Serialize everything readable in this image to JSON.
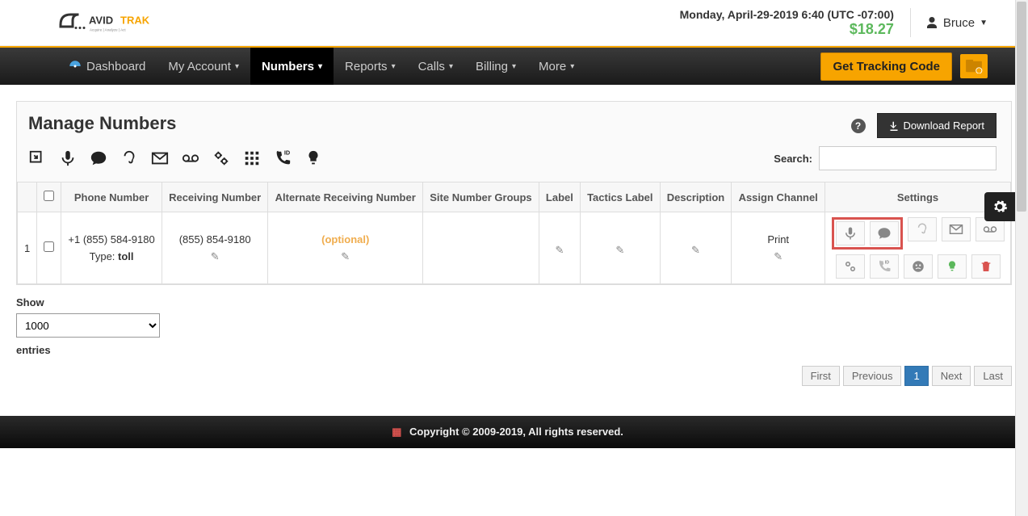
{
  "brand": {
    "name": "AVIDTRAK",
    "tagline": "Acquire | Analyze | Act"
  },
  "header": {
    "datetime": "Monday, April-29-2019 6:40 (UTC -07:00)",
    "balance": "$18.27",
    "user_name": "Bruce"
  },
  "nav": {
    "items": [
      {
        "label": "Dashboard"
      },
      {
        "label": "My Account"
      },
      {
        "label": "Numbers"
      },
      {
        "label": "Reports"
      },
      {
        "label": "Calls"
      },
      {
        "label": "Billing"
      },
      {
        "label": "More"
      }
    ],
    "get_code_label": "Get Tracking Code"
  },
  "page": {
    "title": "Manage Numbers",
    "download_label": "Download Report",
    "search_label": "Search:",
    "search_value": ""
  },
  "table": {
    "headers": {
      "phone_number": "Phone Number",
      "receiving_number": "Receiving Number",
      "alt_receiving_number": "Alternate Receiving Number",
      "site_number_groups": "Site Number Groups",
      "label": "Label",
      "tactics_label": "Tactics Label",
      "description": "Description",
      "assign_channel": "Assign Channel",
      "settings": "Settings"
    },
    "rows": [
      {
        "idx": "1",
        "phone_number": "+1 (855) 584-9180",
        "type_label": "Type:",
        "type_value": "toll",
        "receiving_number": "(855) 854-9180",
        "alt_receiving_number": "(optional)",
        "assign_channel": "Print"
      }
    ]
  },
  "list_controls": {
    "show_label": "Show",
    "show_value": "1000",
    "entries_label": "entries"
  },
  "pagination": {
    "first": "First",
    "previous": "Previous",
    "current": "1",
    "next": "Next",
    "last": "Last"
  },
  "footer": {
    "copyright": "Copyright © 2009-2019, All rights reserved."
  },
  "colors": {
    "accent_orange": "#f7a400",
    "success_green": "#5cb85c",
    "danger_red": "#d9534f",
    "nav_bg": "#1a1a1a"
  }
}
